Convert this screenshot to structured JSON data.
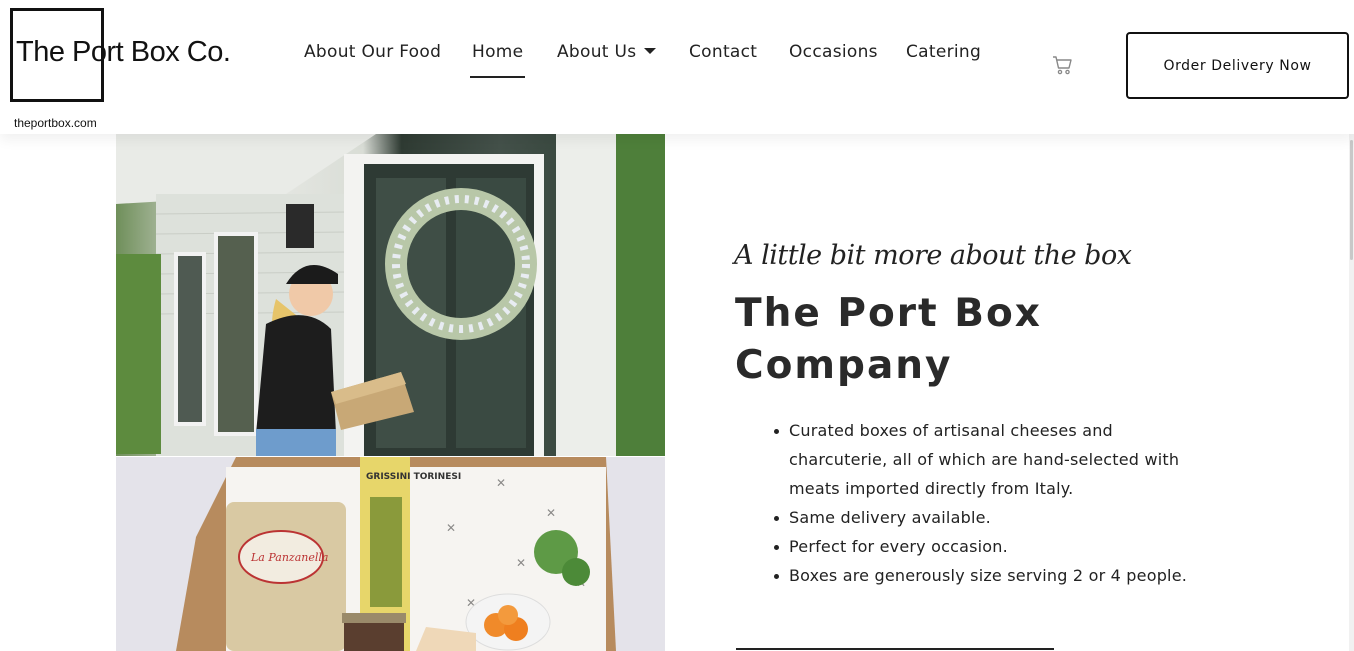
{
  "header": {
    "logo_text": "The Port Box Co.",
    "logo_url": "theportbox.com",
    "nav": [
      {
        "label": "About Our Food"
      },
      {
        "label": "Home",
        "active": true
      },
      {
        "label": "About Us",
        "has_dropdown": true
      },
      {
        "label": "Contact"
      },
      {
        "label": "Occasions"
      },
      {
        "label": "Catering"
      }
    ],
    "cart_icon": "shopping-cart-icon",
    "order_button": "Order Delivery Now"
  },
  "content": {
    "tagline": "A little bit more about the box",
    "heading": "The Port Box Company",
    "bullets": [
      "Curated boxes of artisanal cheeses and charcuterie, all of which are hand-selected with meats imported directly from Italy.",
      "Same delivery available.",
      "Perfect for every occasion.",
      "Boxes are generously size serving 2 or 4 people."
    ],
    "photo_labels": {
      "breadsticks_brand": "GRISSINI TORINESI",
      "crackers_brand": "La Panzanella"
    }
  },
  "colors": {
    "text": "#222222",
    "accent": "#111111",
    "background": "#ffffff"
  }
}
